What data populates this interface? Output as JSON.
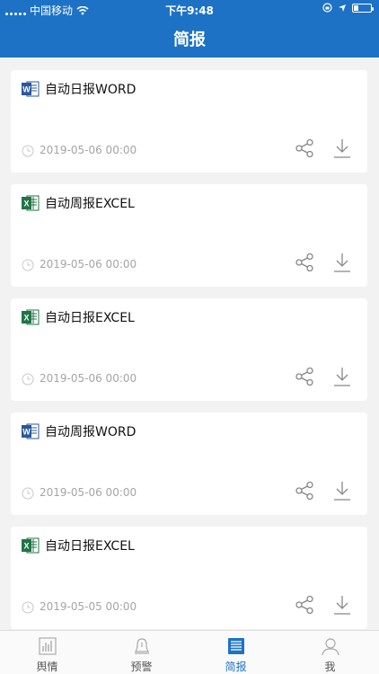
{
  "status_bar": {
    "carrier": "中国移动",
    "time": "下午9:48"
  },
  "header": {
    "title": "简报"
  },
  "reports": [
    {
      "type": "word",
      "name": "自动日报WORD",
      "date": "2019-05-06 00:00"
    },
    {
      "type": "excel",
      "name": "自动周报EXCEL",
      "date": "2019-05-06 00:00"
    },
    {
      "type": "excel",
      "name": "自动日报EXCEL",
      "date": "2019-05-06 00:00"
    },
    {
      "type": "word",
      "name": "自动周报WORD",
      "date": "2019-05-06 00:00"
    },
    {
      "type": "excel",
      "name": "自动日报EXCEL",
      "date": "2019-05-05 00:00"
    }
  ],
  "tabbar": {
    "active_index": 2,
    "tabs": [
      {
        "label": "舆情",
        "icon": "bar-chart-icon"
      },
      {
        "label": "预警",
        "icon": "bell-icon"
      },
      {
        "label": "简报",
        "icon": "document-icon"
      },
      {
        "label": "我",
        "icon": "user-icon"
      }
    ]
  },
  "colors": {
    "accent": "#1d72c6",
    "word": "#2b579a",
    "excel": "#217346",
    "muted": "#a5a5a5"
  }
}
